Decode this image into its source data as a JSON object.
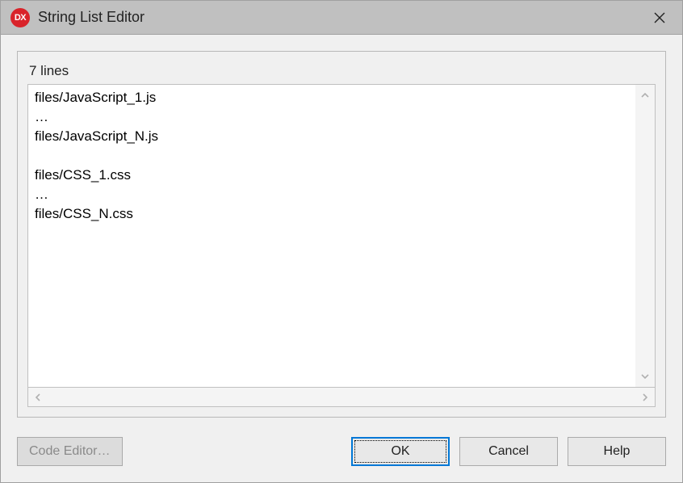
{
  "titlebar": {
    "icon_text": "DX",
    "title": "String List Editor"
  },
  "editor": {
    "line_count_label": "7 lines",
    "content": "files/JavaScript_1.js\n…\nfiles/JavaScript_N.js\n\nfiles/CSS_1.css\n…\nfiles/CSS_N.css"
  },
  "buttons": {
    "code_editor": "Code Editor…",
    "ok": "OK",
    "cancel": "Cancel",
    "help": "Help"
  }
}
